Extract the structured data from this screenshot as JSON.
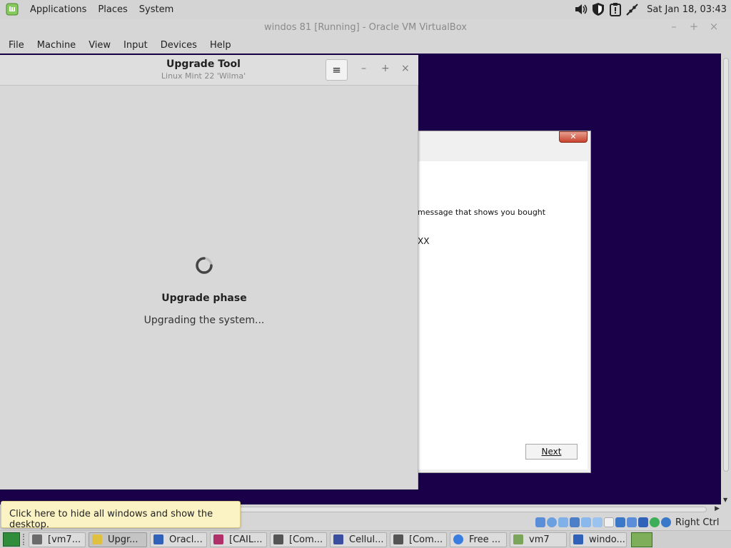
{
  "top_panel": {
    "menus": [
      "Applications",
      "Places",
      "System"
    ],
    "clock": "Sat Jan 18, 03:43",
    "tray_icons": [
      "volume-icon",
      "shield-icon",
      "update-manager-icon",
      "network-disconnected-icon"
    ]
  },
  "vbox": {
    "title": "windos 81 [Running] - Oracle VM VirtualBox",
    "window_controls": [
      "–",
      "+",
      "×"
    ],
    "menus": [
      "File",
      "Machine",
      "View",
      "Input",
      "Devices",
      "Help"
    ],
    "host_key": "Right Ctrl"
  },
  "guest_dialog": {
    "text1": "message that shows you bought",
    "text2": "XX",
    "next_label": "Next",
    "close_glyph": "✕"
  },
  "upgrade_tool": {
    "title": "Upgrade Tool",
    "subtitle": "Linux Mint 22 'Wilma'",
    "menu_glyph": "≡",
    "controls": [
      "–",
      "+",
      "×"
    ],
    "phase": "Upgrade phase",
    "status": "Upgrading the system..."
  },
  "tooltip": "Click here to hide all windows and show the desktop.",
  "taskbar": {
    "tasks": [
      {
        "label": "[vm7...",
        "icon": "terminal-icon",
        "active": false,
        "color": "#6b6b6b"
      },
      {
        "label": "Upgr...",
        "icon": "upgrade-shield-icon",
        "active": true,
        "color": "#e0c040"
      },
      {
        "label": "Oracl...",
        "icon": "virtualbox-icon",
        "active": false,
        "color": "#2f62b8"
      },
      {
        "label": "[CAIL...",
        "icon": "image-viewer-icon",
        "active": false,
        "color": "#b0306a"
      },
      {
        "label": "[Com...",
        "icon": "terminal-icon",
        "active": false,
        "color": "#555555"
      },
      {
        "label": "Cellul...",
        "icon": "app-window-icon",
        "active": false,
        "color": "#3a4fa0"
      },
      {
        "label": "[Com...",
        "icon": "terminal-icon",
        "active": false,
        "color": "#555555"
      },
      {
        "label": "Free ...",
        "icon": "chrome-icon",
        "active": false,
        "color": "#3a7de0"
      },
      {
        "label": "vm7",
        "icon": "folder-icon",
        "active": false,
        "color": "#7aa55a"
      },
      {
        "label": "windo...",
        "icon": "virtualbox-icon",
        "active": false,
        "color": "#2f62b8"
      }
    ]
  }
}
